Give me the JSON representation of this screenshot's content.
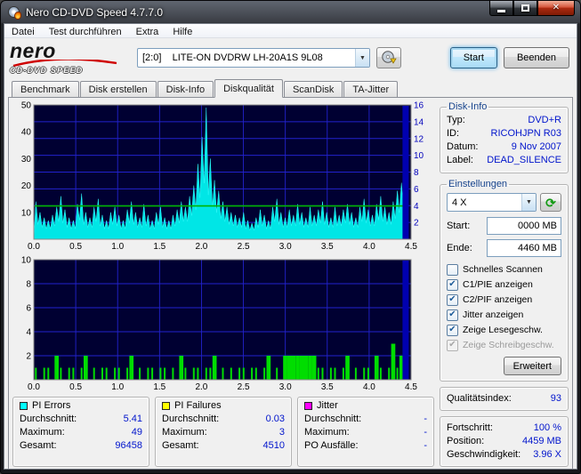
{
  "window": {
    "title": "Nero CD-DVD Speed 4.7.7.0"
  },
  "menu": {
    "items": [
      "Datei",
      "Test durchführen",
      "Extra",
      "Hilfe"
    ]
  },
  "toolbar": {
    "logo_top": "nero",
    "logo_bottom": "CD-DVD SPEED",
    "drive": "[2:0]    LITE-ON DVDRW LH-20A1S 9L08",
    "start_label": "Start",
    "quit_label": "Beenden"
  },
  "tabs": [
    {
      "label": "Benchmark",
      "active": false
    },
    {
      "label": "Disk erstellen",
      "active": false
    },
    {
      "label": "Disk-Info",
      "active": false
    },
    {
      "label": "Diskqualität",
      "active": true
    },
    {
      "label": "ScanDisk",
      "active": false
    },
    {
      "label": "TA-Jitter",
      "active": false
    }
  ],
  "disk_info": {
    "legend": "Disk-Info",
    "rows": [
      {
        "label": "Typ:",
        "value": "DVD+R"
      },
      {
        "label": "ID:",
        "value": "RICOHJPN R03"
      },
      {
        "label": "Datum:",
        "value": "9 Nov 2007"
      },
      {
        "label": "Label:",
        "value": "DEAD_SILENCE"
      }
    ]
  },
  "settings": {
    "legend": "Einstellungen",
    "speed_value": "4 X",
    "start_label": "Start:",
    "start_value": "0000 MB",
    "end_label": "Ende:",
    "end_value": "4460 MB",
    "checkboxes": [
      {
        "label": "Schnelles Scannen",
        "checked": false,
        "disabled": false
      },
      {
        "label": "C1/PIE anzeigen",
        "checked": true,
        "disabled": false
      },
      {
        "label": "C2/PIF anzeigen",
        "checked": true,
        "disabled": false
      },
      {
        "label": "Jitter anzeigen",
        "checked": true,
        "disabled": false
      },
      {
        "label": "Zeige Lesegeschw.",
        "checked": true,
        "disabled": false
      },
      {
        "label": "Zeige Schreibgeschw.",
        "checked": true,
        "disabled": true
      }
    ],
    "advanced_label": "Erweitert"
  },
  "quality": {
    "label": "Qualitätsindex:",
    "value": "93"
  },
  "progress": {
    "rows": [
      {
        "label": "Fortschritt:",
        "value": "100 %"
      },
      {
        "label": "Position:",
        "value": "4459 MB"
      },
      {
        "label": "Geschwindigkeit:",
        "value": "3.96 X"
      }
    ]
  },
  "stats": [
    {
      "title": "PI Errors",
      "color": "#00ffff",
      "rows": [
        [
          "Durchschnitt:",
          "5.41"
        ],
        [
          "Maximum:",
          "49"
        ],
        [
          "Gesamt:",
          "96458"
        ]
      ]
    },
    {
      "title": "PI Failures",
      "color": "#ffff00",
      "rows": [
        [
          "Durchschnitt:",
          "0.03"
        ],
        [
          "Maximum:",
          "3"
        ],
        [
          "Gesamt:",
          "4510"
        ]
      ]
    },
    {
      "title": "Jitter",
      "color": "#ff00ff",
      "rows": [
        [
          "Durchschnitt:",
          "-"
        ],
        [
          "Maximum:",
          "-"
        ],
        [
          "PO Ausfälle:",
          "-"
        ]
      ]
    }
  ],
  "chart_data": [
    {
      "type": "area",
      "name": "PI Errors (PIE) vs. position (GB)",
      "x_range": [
        0,
        4.5
      ],
      "data_end": 4.46,
      "x_divisions": 9,
      "y_divisions": 8,
      "y_left_range": [
        0,
        50
      ],
      "y_left_ticks": [
        10,
        20,
        30,
        40,
        50
      ],
      "y_right_range": [
        0,
        16
      ],
      "y_right_ticks": [
        2,
        4,
        6,
        8,
        10,
        12,
        14,
        16
      ],
      "x_ticks": [
        "0.0",
        "0.5",
        "1.0",
        "1.5",
        "2.0",
        "2.5",
        "3.0",
        "3.5",
        "4.0",
        "4.5"
      ],
      "series_color": "#00e6e6",
      "grid_color": "#2222cc",
      "bg_color": "#000032",
      "speed_line": {
        "color": "#00b400",
        "value": 3.96,
        "axis": "right"
      },
      "end_spike": {
        "x": 4.43,
        "color": "#0000b0"
      },
      "values": [
        14,
        10,
        8,
        7,
        9,
        12,
        16,
        11,
        8,
        7,
        13,
        17,
        10,
        8,
        12,
        15,
        9,
        7,
        10,
        12,
        9,
        7,
        11,
        14,
        10,
        8,
        13,
        9,
        7,
        10,
        12,
        8,
        7,
        9,
        11,
        14,
        12,
        16,
        20,
        28,
        38,
        49,
        30,
        22,
        18,
        14,
        12,
        10,
        9,
        8,
        10,
        7,
        6,
        8,
        11,
        9,
        7,
        12,
        15,
        10,
        8,
        11,
        9,
        13,
        10,
        8,
        12,
        9,
        11,
        14,
        10,
        8,
        12,
        9,
        11,
        13,
        10,
        8,
        12,
        15,
        11,
        9,
        13,
        16,
        12,
        10,
        14,
        18,
        21,
        24
      ]
    },
    {
      "type": "bar",
      "name": "PI Failures (PIF) vs. position (GB)",
      "x_range": [
        0,
        4.5
      ],
      "data_end": 4.46,
      "x_divisions": 9,
      "y_divisions": 5,
      "y_left_range": [
        0,
        10
      ],
      "y_left_ticks": [
        2,
        4,
        6,
        8,
        10
      ],
      "x_ticks": [
        "0.0",
        "0.5",
        "1.0",
        "1.5",
        "2.0",
        "2.5",
        "3.0",
        "3.5",
        "4.0",
        "4.5"
      ],
      "series_color": "#00dd00",
      "grid_color": "#2222cc",
      "bg_color": "#000032",
      "end_spike": {
        "x": 4.43,
        "color": "#0000b0"
      },
      "values": [
        1,
        0,
        1,
        1,
        0,
        2,
        1,
        0,
        1,
        1,
        0,
        1,
        2,
        0,
        1,
        0,
        1,
        1,
        0,
        1,
        1,
        0,
        1,
        2,
        0,
        1,
        0,
        1,
        1,
        0,
        1,
        1,
        0,
        1,
        0,
        2,
        1,
        0,
        1,
        1,
        0,
        1,
        1,
        2,
        0,
        1,
        0,
        1,
        0,
        1,
        1,
        0,
        1,
        1,
        0,
        1,
        2,
        0,
        1,
        0,
        2,
        2,
        2,
        2,
        2,
        2,
        2,
        2,
        1,
        1,
        0,
        1,
        1,
        0,
        1,
        2,
        0,
        1,
        0,
        1,
        1,
        0,
        2,
        1,
        0,
        1,
        3,
        1,
        2,
        1
      ]
    }
  ]
}
